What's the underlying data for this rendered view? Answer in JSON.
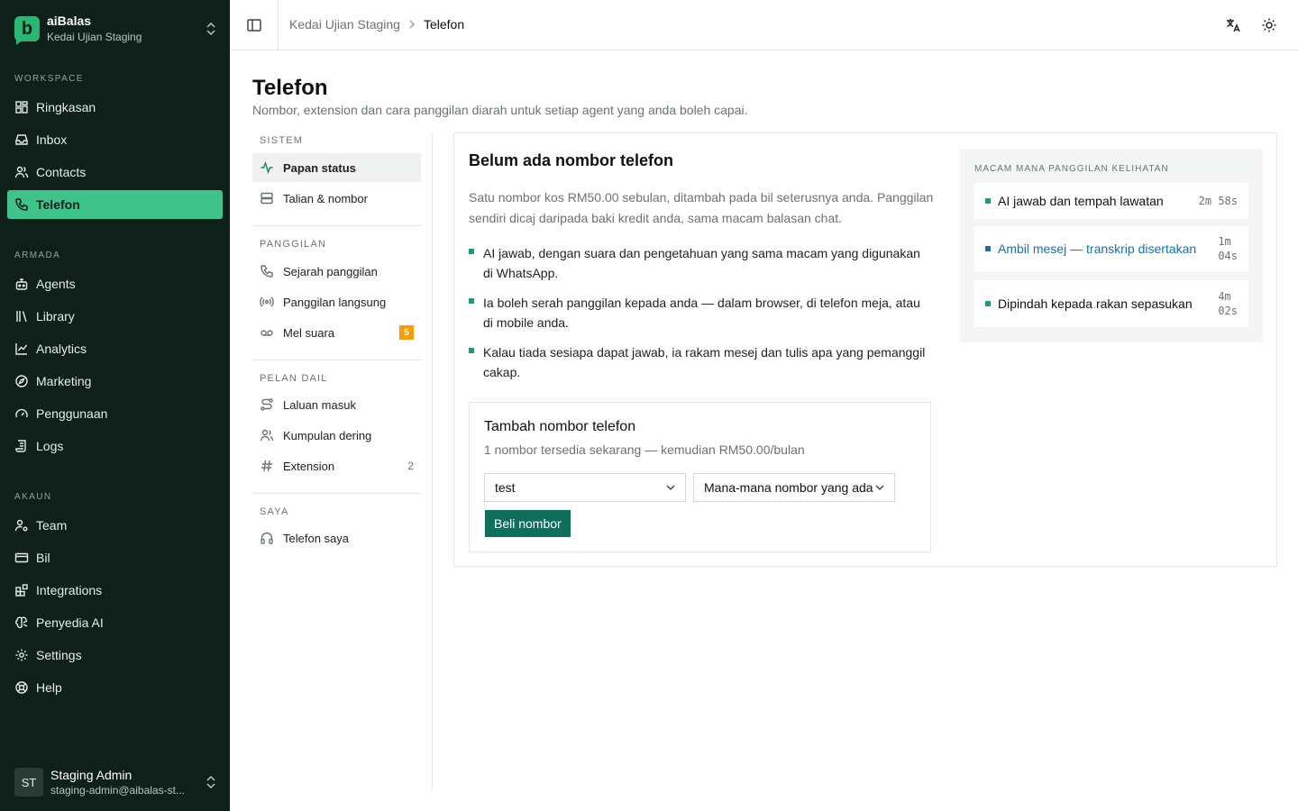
{
  "workspace": {
    "name": "aiBalas",
    "sub": "Kedai Ujian Staging",
    "logo_letter": "b"
  },
  "sidebar": {
    "sections": [
      {
        "label": "WORKSPACE",
        "items": [
          "Ringkasan",
          "Inbox",
          "Contacts",
          "Telefon"
        ]
      },
      {
        "label": "ARMADA",
        "items": [
          "Agents",
          "Library",
          "Analytics",
          "Marketing",
          "Penggunaan",
          "Logs"
        ]
      },
      {
        "label": "AKAUN",
        "items": [
          "Team",
          "Bil",
          "Integrations",
          "Penyedia AI",
          "Settings",
          "Help"
        ]
      }
    ],
    "active": "Telefon"
  },
  "user": {
    "initials": "ST",
    "name": "Staging Admin",
    "email": "staging-admin@aibalas-st..."
  },
  "topbar": {
    "crumb_1": "Kedai Ujian Staging",
    "crumb_2": "Telefon"
  },
  "page": {
    "title": "Telefon",
    "subtitle": "Nombor, extension dan cara panggilan diarah untuk setiap agent yang anda boleh capai."
  },
  "subnav": {
    "sections": [
      {
        "label": "SISTEM",
        "items": [
          {
            "label": "Papan status"
          },
          {
            "label": "Talian & nombor"
          }
        ]
      },
      {
        "label": "PANGGILAN",
        "items": [
          {
            "label": "Sejarah panggilan"
          },
          {
            "label": "Panggilan langsung"
          },
          {
            "label": "Mel suara",
            "badge": "5"
          }
        ]
      },
      {
        "label": "PELAN DAIL",
        "items": [
          {
            "label": "Laluan masuk"
          },
          {
            "label": "Kumpulan dering"
          },
          {
            "label": "Extension",
            "count": "2"
          }
        ]
      },
      {
        "label": "SAYA",
        "items": [
          {
            "label": "Telefon saya"
          }
        ]
      }
    ]
  },
  "card": {
    "title": "Belum ada nombor telefon",
    "desc": "Satu nombor kos RM50.00 sebulan, ditambah pada bil seterusnya anda. Panggilan sendiri dicaj daripada baki kredit anda, sama macam balasan chat.",
    "bullets": [
      "AI jawab, dengan suara dan pengetahuan yang sama macam yang digunakan di WhatsApp.",
      "Ia boleh serah panggilan kepada anda — dalam browser, di telefon meja, atau di mobile anda.",
      "Kalau tiada sesiapa dapat jawab, ia rakam mesej dan tulis apa yang pemanggil cakap."
    ],
    "add": {
      "title": "Tambah nombor telefon",
      "sub": "1 nombor tersedia sekarang — kemudian RM50.00/bulan",
      "select_1": "test",
      "select_2": "Mana-mana nombor yang ada",
      "buy_label": "Beli nombor"
    },
    "how": {
      "label": "MACAM MANA PANGGILAN KELIHATAN",
      "items": [
        {
          "text": "AI jawab dan tempah lawatan",
          "dur": "2m 58s",
          "color": "#1f9d67"
        },
        {
          "text": "Ambil mesej — transkrip disertakan",
          "dur_1": "1m",
          "dur_2": "04s",
          "color": "#1d6fa5"
        },
        {
          "text": "Dipindah kepada rakan sepasukan",
          "dur_1": "4m",
          "dur_2": "02s",
          "color": "#1f9d67"
        }
      ]
    }
  },
  "colors": {
    "sidebar_bg": "#0f1f1a",
    "active_green": "#3fc38a",
    "primary_button": "#0f6f5c",
    "badge_orange": "#f59e0b",
    "link_blue": "#1d6fa5"
  }
}
